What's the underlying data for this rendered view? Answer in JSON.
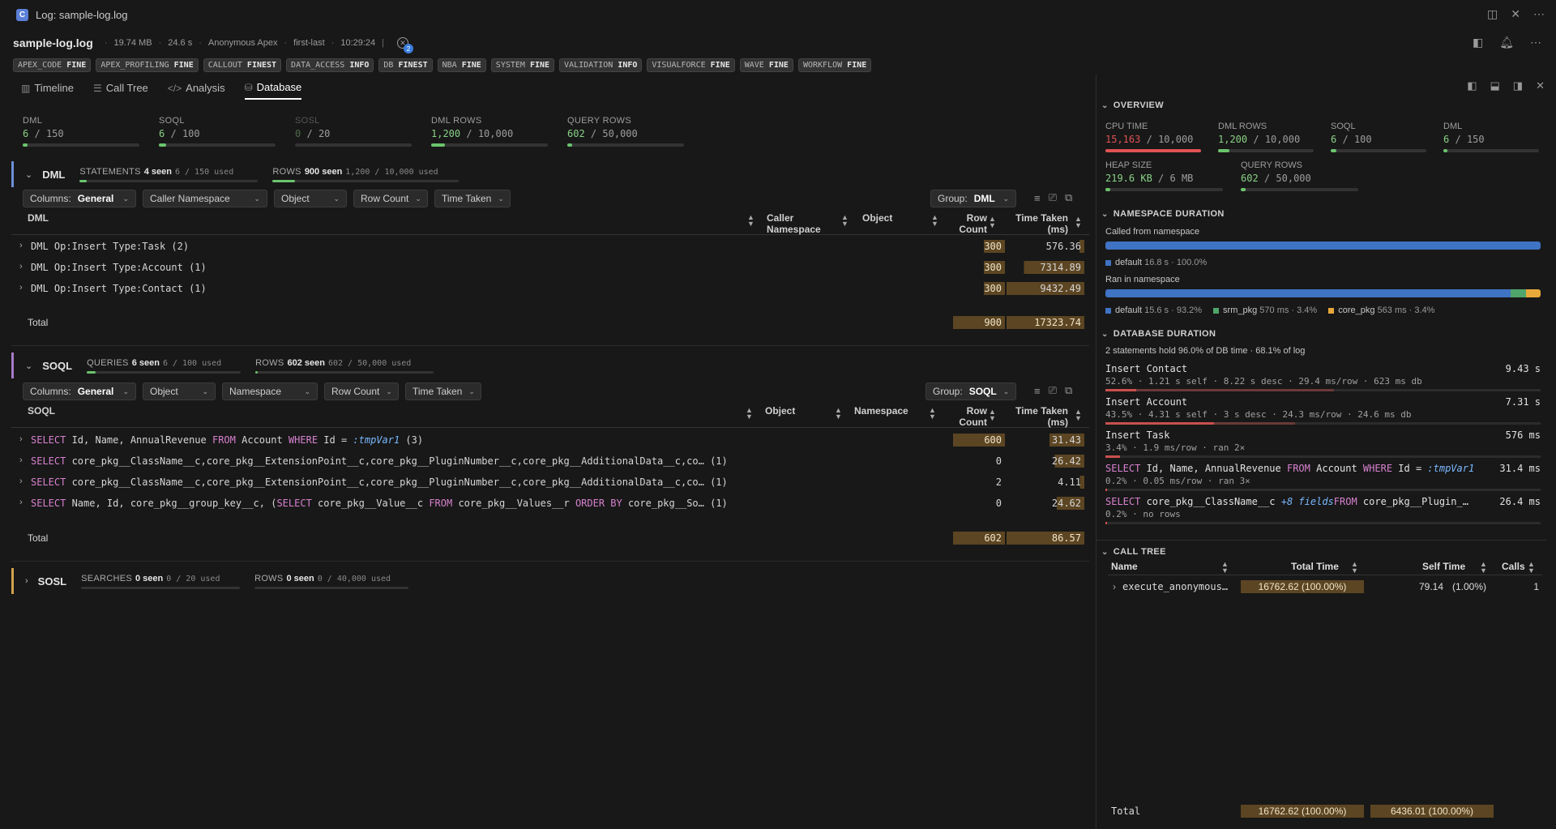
{
  "window": {
    "title": "Log: sample-log.log",
    "logo_letter": "C"
  },
  "header": {
    "file": "sample-log.log",
    "size": "19.74 MB",
    "duration": "24.6 s",
    "user": "Anonymous Apex",
    "mode": "first-last",
    "time": "10:29:24",
    "issues_count": "2"
  },
  "log_levels": [
    {
      "cat": "APEX_CODE",
      "lvl": "FINE"
    },
    {
      "cat": "APEX_PROFILING",
      "lvl": "FINE"
    },
    {
      "cat": "CALLOUT",
      "lvl": "FINEST"
    },
    {
      "cat": "DATA_ACCESS",
      "lvl": "INFO"
    },
    {
      "cat": "DB",
      "lvl": "FINEST"
    },
    {
      "cat": "NBA",
      "lvl": "FINE"
    },
    {
      "cat": "SYSTEM",
      "lvl": "FINE"
    },
    {
      "cat": "VALIDATION",
      "lvl": "INFO"
    },
    {
      "cat": "VISUALFORCE",
      "lvl": "FINE"
    },
    {
      "cat": "WAVE",
      "lvl": "FINE"
    },
    {
      "cat": "WORKFLOW",
      "lvl": "FINE"
    }
  ],
  "tabs": [
    {
      "label": "Timeline"
    },
    {
      "label": "Call Tree"
    },
    {
      "label": "Analysis"
    },
    {
      "label": "Database"
    }
  ],
  "summary": [
    {
      "label": "DML",
      "value": "6",
      "limit": "150",
      "fraction": 0.04
    },
    {
      "label": "SOQL",
      "value": "6",
      "limit": "100",
      "fraction": 0.06
    },
    {
      "label": "SOSL",
      "value": "0",
      "limit": "20",
      "fraction": 0
    },
    {
      "label": "DML ROWS",
      "value": "1,200",
      "limit": "10,000",
      "fraction": 0.12
    },
    {
      "label": "QUERY ROWS",
      "value": "602",
      "limit": "50,000",
      "fraction": 0.012
    }
  ],
  "dml": {
    "title": "DML",
    "statements": {
      "label": "STATEMENTS",
      "seen": "4 seen",
      "used": "6 / 150 used"
    },
    "rows": {
      "label": "ROWS",
      "seen": "900 seen",
      "used": "1,200 / 10,000 used"
    },
    "toolbar": {
      "columns": "Columns:",
      "columns_val": "General",
      "f1": "Caller Namespace",
      "f2": "Object",
      "f3": "Row Count",
      "f4": "Time Taken",
      "group": "Group:",
      "group_val": "DML"
    },
    "headers": {
      "name": "DML",
      "caller_ns": "Caller Namespace",
      "object": "Object",
      "row_count": "Row Count",
      "time_taken": "Time Taken (ms)"
    },
    "rows_data": [
      {
        "name": "DML Op:Insert Type:Task (2)",
        "row_count": "300",
        "time_taken": "576.36"
      },
      {
        "name": "DML Op:Insert Type:Account (1)",
        "row_count": "300",
        "time_taken": "7314.89"
      },
      {
        "name": "DML Op:Insert Type:Contact (1)",
        "row_count": "300",
        "time_taken": "9432.49"
      }
    ],
    "total": {
      "label": "Total",
      "row_count": "900",
      "time_taken": "17323.74"
    }
  },
  "soql": {
    "title": "SOQL",
    "queries": {
      "label": "QUERIES",
      "seen": "6 seen",
      "used": "6 / 100 used"
    },
    "rows": {
      "label": "ROWS",
      "seen": "602 seen",
      "used": "602 / 50,000 used"
    },
    "toolbar": {
      "columns": "Columns:",
      "columns_val": "General",
      "f1": "Object",
      "f2": "Namespace",
      "f3": "Row Count",
      "f4": "Time Taken",
      "group": "Group:",
      "group_val": "SOQL"
    },
    "headers": {
      "name": "SOQL",
      "object": "Object",
      "namespace": "Namespace",
      "row_count": "Row Count",
      "time_taken": "Time Taken (ms)"
    },
    "rows_data": [
      {
        "k1": "SELECT",
        "p1": " Id, Name, AnnualRevenue ",
        "k2": "FROM",
        "p2": " Account ",
        "k3": "WHERE",
        "p3": " Id = ",
        "var": ":tmpVar1",
        "p4": " (3)",
        "row_count": "600",
        "time_taken": "31.43"
      },
      {
        "k1": "SELECT",
        "p1": " core_pkg__ClassName__c,core_pkg__ExtensionPoint__c,core_pkg__PluginNumber__c,core_pkg__AdditionalData__c,co… (1)",
        "row_count": "0",
        "time_taken": "26.42"
      },
      {
        "k1": "SELECT",
        "p1": " core_pkg__ClassName__c,core_pkg__ExtensionPoint__c,core_pkg__PluginNumber__c,core_pkg__AdditionalData__c,co… (1)",
        "row_count": "2",
        "time_taken": "4.11"
      },
      {
        "k1": "SELECT",
        "p1": " Name, Id, core_pkg__group_key__c, (",
        "k2": "SELECT",
        "p2": " core_pkg__Value__c ",
        "k3": "FROM",
        "p3": " core_pkg__Values__r ",
        "k4": "ORDER BY",
        "p4": " core_pkg__So… (1)",
        "row_count": "0",
        "time_taken": "24.62"
      }
    ],
    "total": {
      "label": "Total",
      "row_count": "602",
      "time_taken": "86.57"
    }
  },
  "sosl": {
    "title": "SOSL",
    "searches": {
      "label": "SEARCHES",
      "seen": "0 seen",
      "used": "0 / 20 used"
    },
    "rows": {
      "label": "ROWS",
      "seen": "0 seen",
      "used": "0 / 40,000 used"
    }
  },
  "panel": {
    "overview": {
      "title": "OVERVIEW",
      "metrics": [
        {
          "label": "CPU TIME",
          "value": "15,163",
          "limit": "10,000",
          "fraction": 1.0,
          "color": "#e05252"
        },
        {
          "label": "DML ROWS",
          "value": "1,200",
          "limit": "10,000",
          "fraction": 0.12,
          "color": "#6bc46d"
        },
        {
          "label": "SOQL",
          "value": "6",
          "limit": "100",
          "fraction": 0.06,
          "color": "#6bc46d"
        },
        {
          "label": "DML",
          "value": "6",
          "limit": "150",
          "fraction": 0.04,
          "color": "#6bc46d"
        },
        {
          "label": "HEAP SIZE",
          "value": "219.6 KB",
          "limit": "6 MB",
          "fraction": 0.036,
          "color": "#6bc46d"
        },
        {
          "label": "QUERY ROWS",
          "value": "602",
          "limit": "50,000",
          "fraction": 0.012,
          "color": "#6bc46d"
        }
      ]
    },
    "namespace": {
      "title": "NAMESPACE DURATION",
      "called_label": "Called from namespace",
      "called_legend": [
        {
          "name": "default",
          "detail": "16.8 s · 100.0%",
          "color": "#3f73c4",
          "fraction": 1.0
        }
      ],
      "ran_label": "Ran in namespace",
      "ran_legend": [
        {
          "name": "default",
          "detail": "15.6 s · 93.2%",
          "color": "#3f73c4",
          "fraction": 0.932
        },
        {
          "name": "srm_pkg",
          "detail": "570 ms · 3.4%",
          "color": "#4fa56a",
          "fraction": 0.034
        },
        {
          "name": "core_pkg",
          "detail": "563 ms · 3.4%",
          "color": "#e8a93a",
          "fraction": 0.034
        }
      ]
    },
    "database": {
      "title": "DATABASE DURATION",
      "summary": "2 statements hold 96.0% of DB time · 68.1% of log",
      "items": [
        {
          "t": "Insert Contact",
          "v": "9.43 s",
          "d": "52.6% · 1.21 s self · 8.22 s desc · 29.4 ms/row · 623 ms db",
          "self": 0.07,
          "total": 0.526
        },
        {
          "t": "Insert Account",
          "v": "7.31 s",
          "d": "43.5% · 4.31 s self · 3 s desc · 24.3 ms/row · 24.6 ms db",
          "self": 0.25,
          "total": 0.435
        },
        {
          "t": "Insert Task",
          "v": "576 ms",
          "d": "3.4% · 1.9 ms/row · ran 2×",
          "self": 0.034,
          "total": 0.034
        },
        {
          "k1": "SELECT",
          "p1": " Id, Name, AnnualRevenue ",
          "k2": "FROM",
          "p2": " Account ",
          "k3": "WHERE",
          "p3": " Id = ",
          "var": ":tmpVar1",
          "v": "31.4 ms",
          "d": "0.2% · 0.05 ms/row · ran 3×",
          "self": 0.002,
          "total": 0.002
        },
        {
          "k1": "SELECT",
          "p1": " core_pkg__ClassName__c ",
          "var": "+8 fields",
          "k2": "FROM",
          "p2": " core_pkg__Plugin_…",
          "v": "26.4 ms",
          "d": "0.2% · no rows",
          "self": 0.002,
          "total": 0.002
        }
      ]
    },
    "calltree": {
      "title": "CALL TREE",
      "headers": {
        "name": "Name",
        "total": "Total Time",
        "self": "Self Time",
        "calls": "Calls"
      },
      "rows": [
        {
          "name": "execute_anonymous…",
          "total": "16762.62 (100.00%)",
          "self": "79.14",
          "self_pct": "(1.00%)",
          "calls": "1"
        }
      ],
      "total": {
        "label": "Total",
        "total": "16762.62 (100.00%)",
        "self": "6436.01 (100.00%)"
      }
    }
  }
}
